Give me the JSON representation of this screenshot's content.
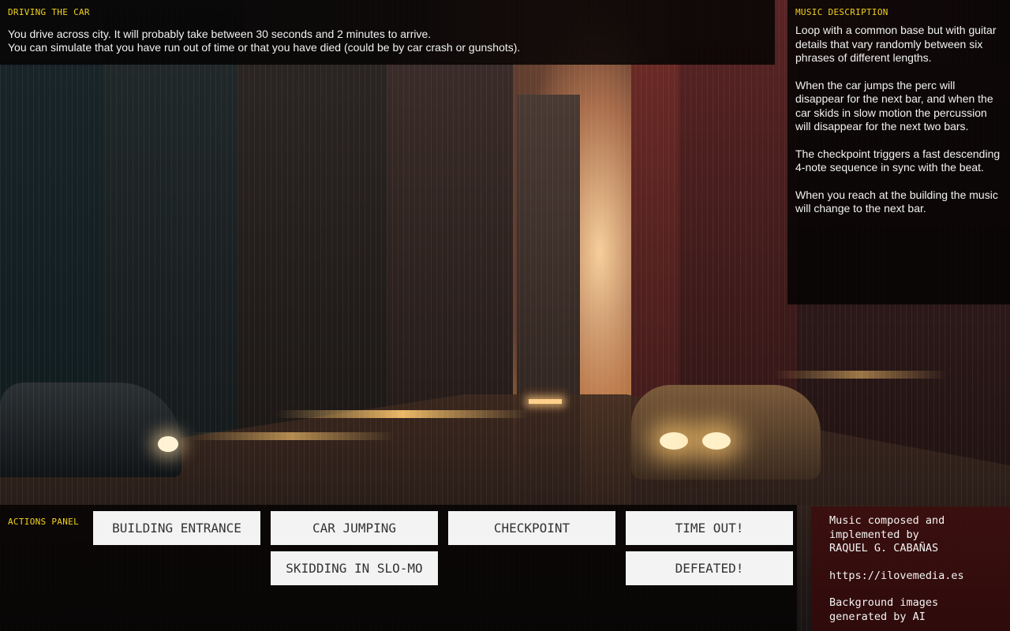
{
  "driving": {
    "label": "DRIVING THE CAR",
    "line1": "You drive across city. It will probably take between 30 seconds and 2 minutes to arrive.",
    "line2": "You can simulate that you have run out of time or that you have died (could be by car crash or gunshots)."
  },
  "music": {
    "label": "MUSIC DESCRIPTION",
    "paragraphs": [
      "Loop with a common base but with guitar details that vary randomly between six phrases of different lengths.",
      "When the car jumps the perc will disappear for the next bar, and when the car skids in slow motion the percussion will disappear for the next two bars.",
      "The checkpoint triggers a fast descending 4-note sequence in sync with the beat.",
      "When you reach at the building the music will change to the next bar."
    ]
  },
  "actions": {
    "label": "ACTIONS PANEL",
    "buttons": {
      "building_entrance": "BUILDING ENTRANCE",
      "car_jumping": "CAR JUMPING",
      "checkpoint": "CHECKPOINT",
      "time_out": "TIME OUT!",
      "skidding": "SKIDDING IN SLO-MO",
      "defeated": "DEFEATED!"
    }
  },
  "credits": {
    "line1": "Music composed and",
    "line2": "implemented by",
    "line3": "RAQUEL G. CABAÑAS",
    "url": "https://ilovemedia.es",
    "line4": "Background images",
    "line5": "generated by AI"
  },
  "colors": {
    "label_yellow": "#f2d21c",
    "panel_bg": "#060404",
    "button_bg": "#f3f3f3",
    "credits_bg": "#3c0e0e"
  }
}
